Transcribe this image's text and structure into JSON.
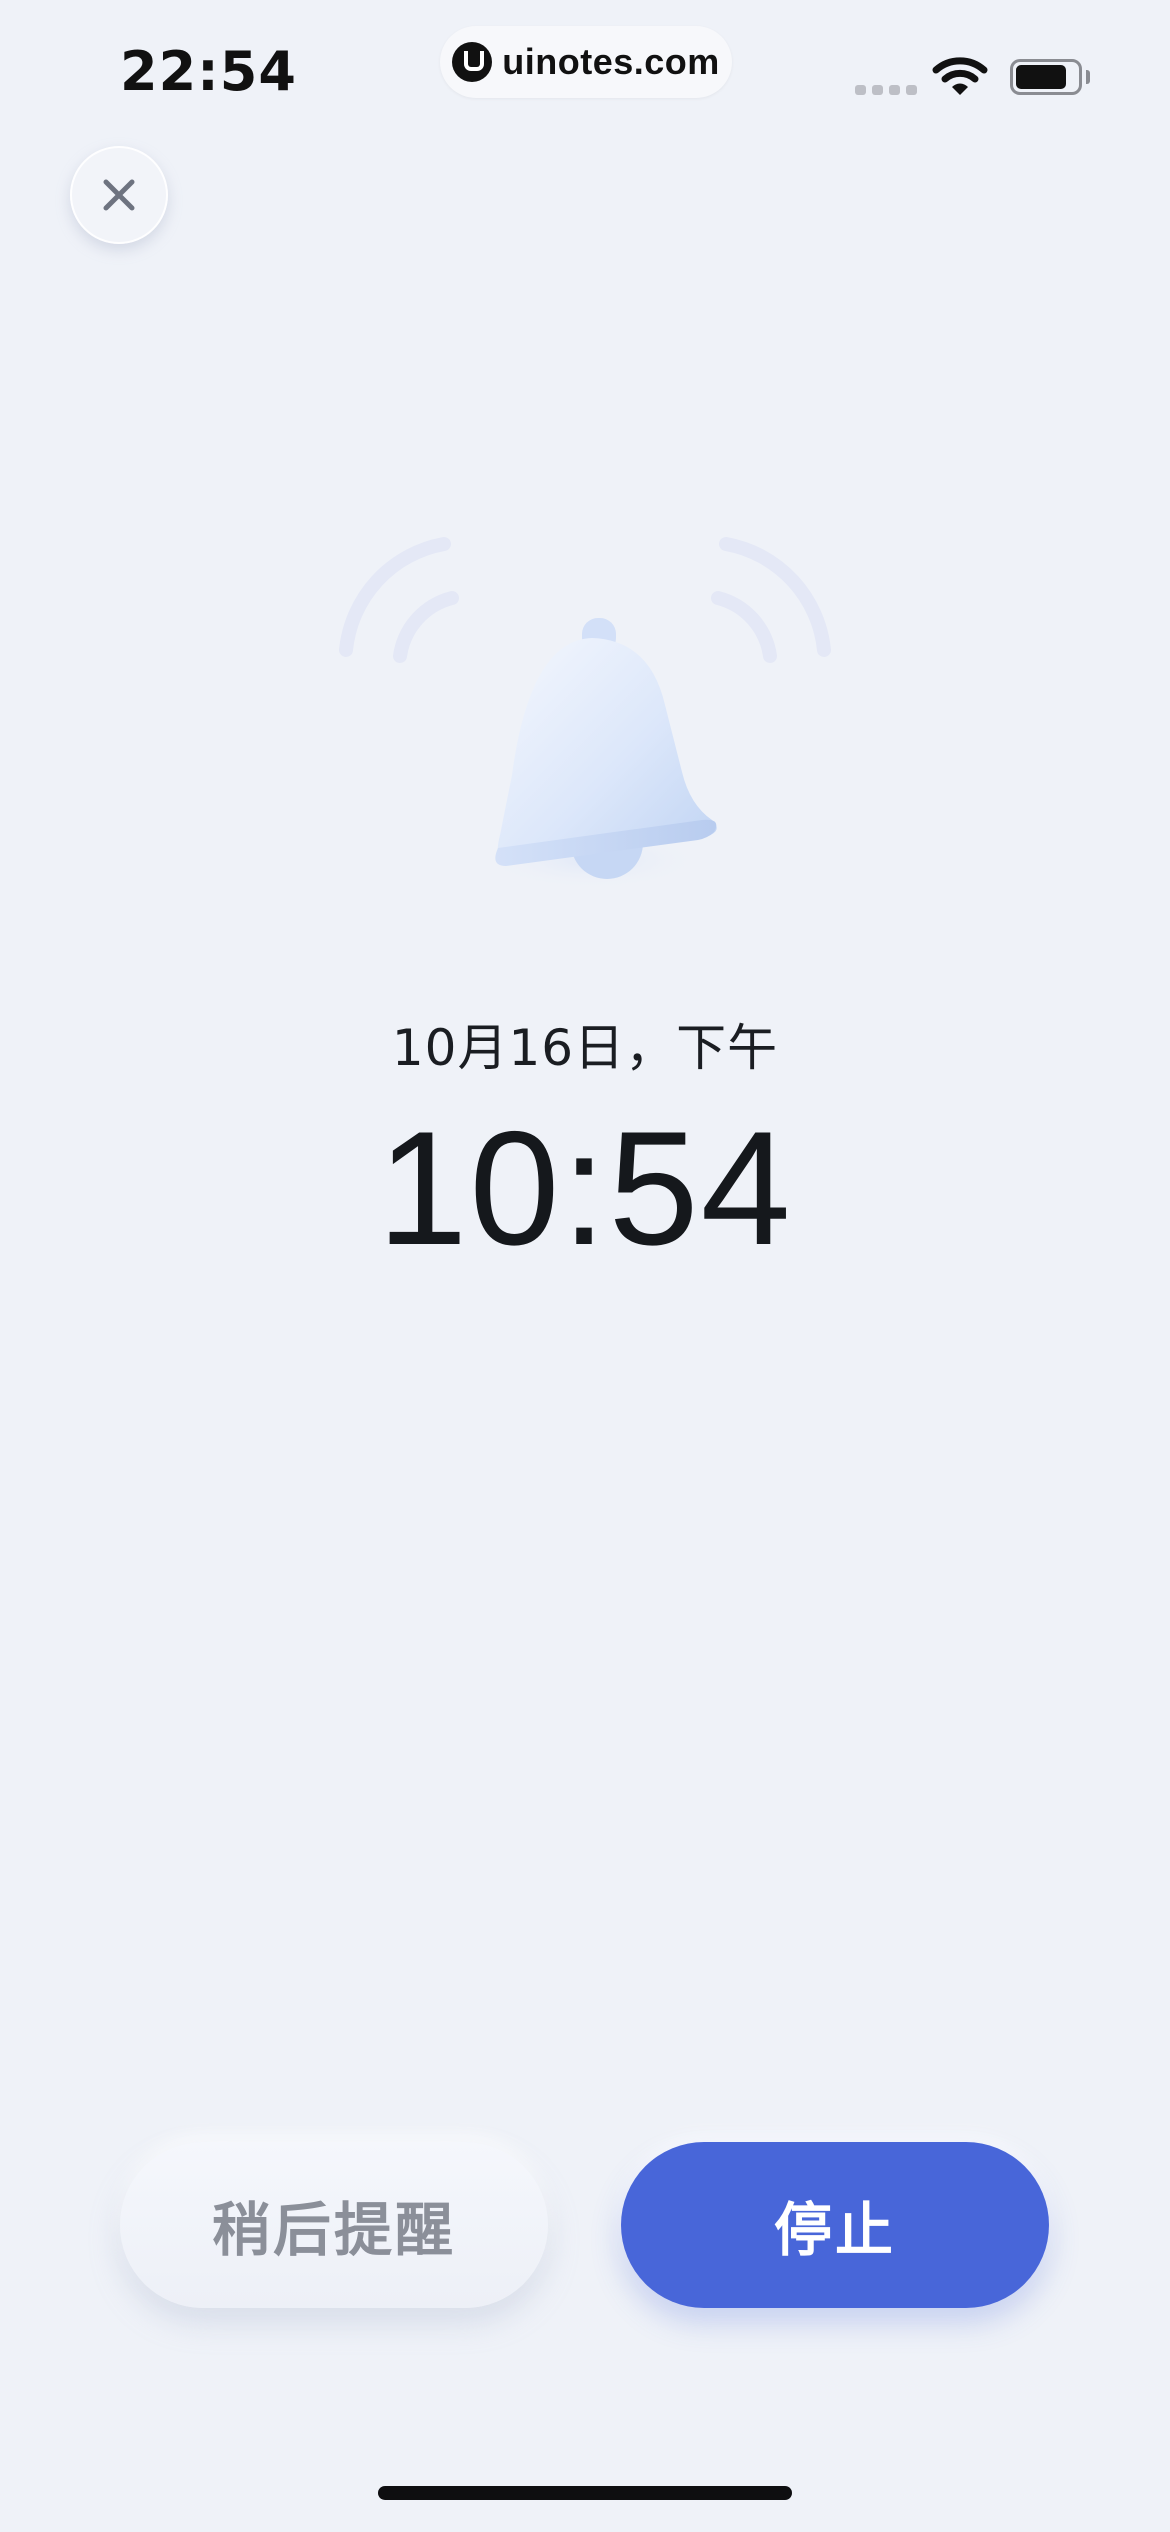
{
  "status_bar": {
    "time": "22:54",
    "watermark": "uinotes.com"
  },
  "alarm": {
    "date_label": "10月16日，下午",
    "time": "10:54"
  },
  "actions": {
    "snooze_label": "稍后提醒",
    "stop_label": "停止"
  },
  "icons": {
    "close": "close-icon",
    "bell": "bell-icon",
    "wifi": "wifi-icon",
    "battery": "battery-icon",
    "signal": "signal-icon"
  },
  "colors": {
    "background": "#EFF2F8",
    "primary": "#4866D9",
    "snooze_text": "#8B8F99",
    "bell": "#C9D9F4"
  }
}
